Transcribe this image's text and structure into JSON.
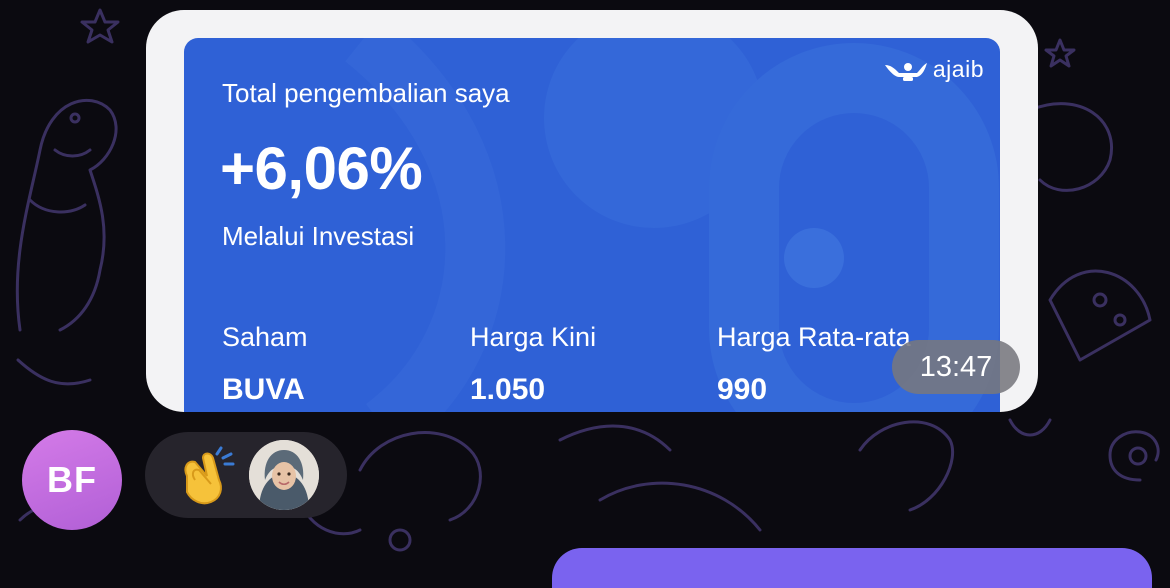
{
  "card": {
    "brand": "ajaib",
    "label": "Total pengembalian saya",
    "return_value": "+6,06%",
    "subtitle": "Melalui Investasi",
    "columns": [
      {
        "header": "Saham",
        "value": "BUVA"
      },
      {
        "header": "Harga Kini",
        "value": "1.050"
      },
      {
        "header": "Harga Rata-rata",
        "value": "990"
      }
    ]
  },
  "message": {
    "time": "13:47"
  },
  "sender": {
    "initials": "BF"
  },
  "reaction": {
    "emoji": "clapping-hands"
  },
  "colors": {
    "background": "#0b0a10",
    "bubble": "#f3f3f5",
    "card": "#2f61d6",
    "avatar": "#c66ee2",
    "outgoing_bubble": "#7a63ef"
  }
}
